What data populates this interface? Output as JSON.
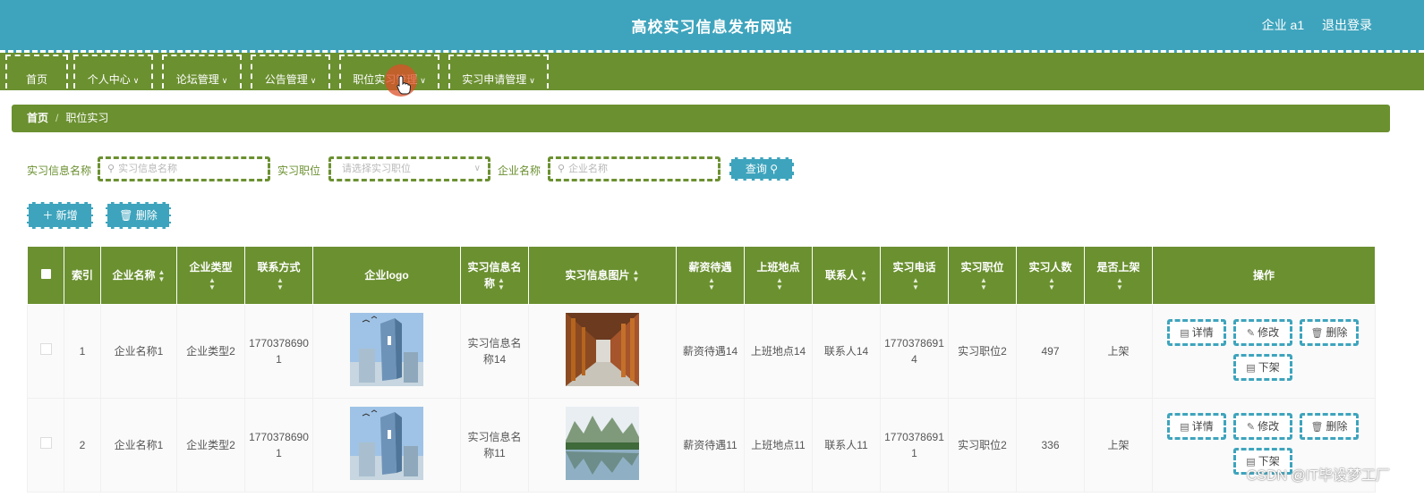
{
  "header": {
    "title": "高校实习信息发布网站",
    "user": "企业 a1",
    "logout": "退出登录"
  },
  "nav": [
    {
      "label": "首页",
      "dropdown": false
    },
    {
      "label": "个人中心",
      "dropdown": true
    },
    {
      "label": "论坛管理",
      "dropdown": true
    },
    {
      "label": "公告管理",
      "dropdown": true
    },
    {
      "label": "职位实习管理",
      "dropdown": true
    },
    {
      "label": "实习申请管理",
      "dropdown": true
    }
  ],
  "breadcrumb": {
    "home": "首页",
    "sep": "/",
    "current": "职位实习"
  },
  "search": {
    "f1_label": "实习信息名称",
    "f1_placeholder": "实习信息名称",
    "f2_label": "实习职位",
    "f2_placeholder": "请选择实习职位",
    "f3_label": "企业名称",
    "f3_placeholder": "企业名称",
    "query": "查询"
  },
  "actions": {
    "add": "新增",
    "delete": "删除"
  },
  "table": {
    "headers": [
      "索引",
      "企业名称",
      "企业类型",
      "联系方式",
      "企业logo",
      "实习信息名称",
      "实习信息图片",
      "薪资待遇",
      "上班地点",
      "联系人",
      "实习电话",
      "实习职位",
      "实习人数",
      "是否上架",
      "操作"
    ],
    "rows": [
      {
        "index": "1",
        "company": "企业名称1",
        "type": "企业类型2",
        "contact": "17703786901",
        "title": "实习信息名称14",
        "salary": "薪资待遇14",
        "location": "上班地点14",
        "person": "联系人14",
        "phone": "17703786914",
        "position": "实习职位2",
        "count": "497",
        "status": "上架"
      },
      {
        "index": "2",
        "company": "企业名称1",
        "type": "企业类型2",
        "contact": "17703786901",
        "title": "实习信息名称11",
        "salary": "薪资待遇11",
        "location": "上班地点11",
        "person": "联系人11",
        "phone": "17703786911",
        "position": "实习职位2",
        "count": "336",
        "status": "上架"
      }
    ],
    "ops": {
      "detail": "详情",
      "edit": "修改",
      "delete": "删除",
      "offshelf": "下架"
    }
  },
  "watermark": "CSDN @IT毕设梦工厂",
  "colors": {
    "header": "#3ea4bd",
    "nav": "#6b9030",
    "button": "#3ea4bd"
  }
}
